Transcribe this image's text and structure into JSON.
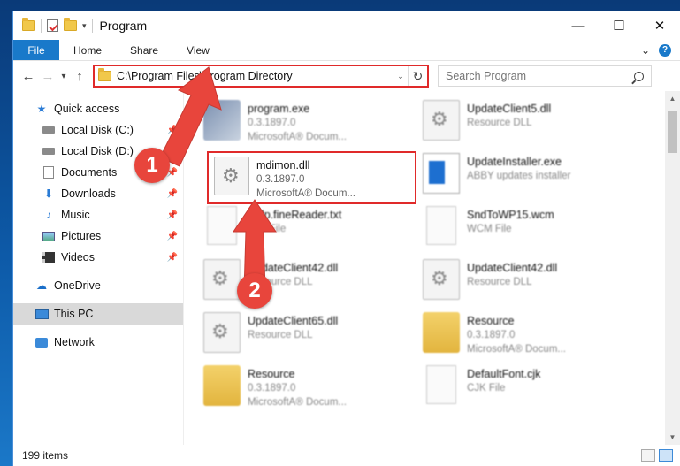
{
  "window": {
    "title": "Program",
    "controls": {
      "minimize": "—",
      "maximize": "☐",
      "close": "✕"
    }
  },
  "ribbon": {
    "tabs": [
      "File",
      "Home",
      "Share",
      "View"
    ],
    "collapse": "⌄",
    "help": "?"
  },
  "address": {
    "path": "C:\\Program Files\\Program Directory",
    "search_placeholder": "Search Program"
  },
  "navpane": {
    "quick_access": "Quick access",
    "items": [
      {
        "label": "Local Disk (C:)",
        "pinned": true
      },
      {
        "label": "Local Disk (D:)",
        "pinned": true
      },
      {
        "label": "Documents",
        "pinned": true
      },
      {
        "label": "Downloads",
        "pinned": true
      },
      {
        "label": "Music",
        "pinned": true
      },
      {
        "label": "Pictures",
        "pinned": true
      },
      {
        "label": "Videos",
        "pinned": true
      }
    ],
    "onedrive": "OneDrive",
    "thispc": "This PC",
    "network": "Network"
  },
  "files": [
    {
      "name": "program.exe",
      "line2": "0.3.1897.0",
      "line3": "MicrosoftA® Docum..."
    },
    {
      "name": "UpdateClient5.dll",
      "line2": "Resource DLL",
      "line3": ""
    },
    {
      "name": "UpdateInstaller.exe",
      "line2": "ABBY updates installer",
      "line3": ""
    },
    {
      "name": "Help.fineReader.txt",
      "line2": "TXT File",
      "line3": ""
    },
    {
      "name": "SndToWP15.wcm",
      "line2": "WCM File",
      "line3": ""
    },
    {
      "name": "UpdateClient42.dll",
      "line2": "Resource DLL",
      "line3": ""
    },
    {
      "name": "UpdateClient42.dll",
      "line2": "Resource DLL",
      "line3": ""
    },
    {
      "name": "UpdateClient65.dll",
      "line2": "Resource DLL",
      "line3": ""
    },
    {
      "name": "Resource",
      "line2": "0.3.1897.0",
      "line3": "MicrosoftA® Docum..."
    },
    {
      "name": "Resource",
      "line2": "0.3.1897.0",
      "line3": "MicrosoftA® Docum..."
    },
    {
      "name": "DefaultFont.cjk",
      "line2": "CJK File",
      "line3": ""
    }
  ],
  "highlighted_file": {
    "name": "mdimon.dll",
    "version": "0.3.1897.0",
    "description": "MicrosoftA® Docum..."
  },
  "status": {
    "count": "199 items"
  },
  "annotations": {
    "badge1": "1",
    "badge2": "2",
    "arrow_color": "#e8453c"
  },
  "colors": {
    "accent": "#1979ca",
    "highlight_border": "#e02a2a",
    "selected_nav": "#d9d9d9"
  }
}
